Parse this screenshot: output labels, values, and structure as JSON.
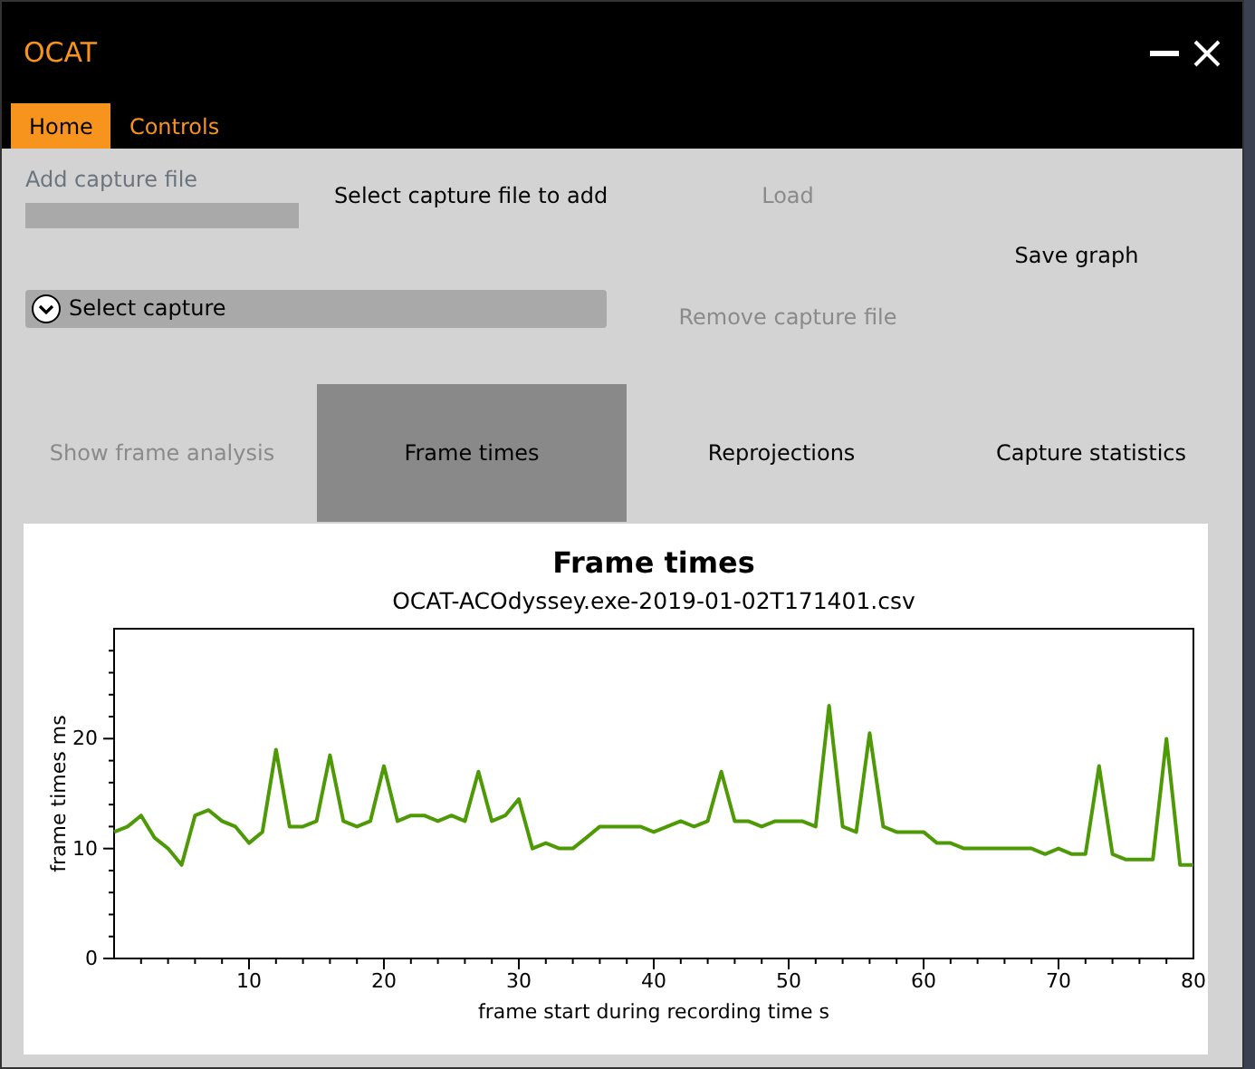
{
  "window": {
    "title": "OCAT"
  },
  "menu_tabs": [
    {
      "label": "Home",
      "selected": true
    },
    {
      "label": "Controls",
      "selected": false
    }
  ],
  "add_capture": {
    "label": "Add capture file",
    "select_button": "Select capture file to add",
    "load_button": {
      "label": "Load",
      "disabled": true
    }
  },
  "save_button": "Save graph",
  "capture_select": {
    "placeholder": "Select capture"
  },
  "remove_button": {
    "label": "Remove capture file",
    "disabled": true
  },
  "view_tabs": [
    {
      "label": "Show frame analysis",
      "selected": false,
      "disabled": true
    },
    {
      "label": "Frame times",
      "selected": true,
      "disabled": false
    },
    {
      "label": "Reprojections",
      "selected": false,
      "disabled": false
    },
    {
      "label": "Capture statistics",
      "selected": false,
      "disabled": false
    }
  ],
  "chart": {
    "chart_data": {
      "type": "line",
      "title": "Frame times",
      "subtitle": "OCAT-ACOdyssey.exe-2019-01-02T171401.csv",
      "xlabel": "frame start during recording time s",
      "ylabel": "frame times ms",
      "x": [
        0,
        1,
        2,
        3,
        4,
        5,
        6,
        7,
        8,
        9,
        10,
        11,
        12,
        13,
        14,
        15,
        16,
        17,
        18,
        19,
        20,
        21,
        22,
        23,
        24,
        25,
        26,
        27,
        28,
        29,
        30,
        31,
        32,
        33,
        34,
        35,
        36,
        37,
        38,
        39,
        40,
        41,
        42,
        43,
        44,
        45,
        46,
        47,
        48,
        49,
        50,
        51,
        52,
        53,
        54,
        55,
        56,
        57,
        58,
        59,
        60,
        61,
        62,
        63,
        64,
        65,
        66,
        67,
        68,
        69,
        70,
        71,
        72,
        73,
        74,
        75,
        76,
        77,
        78,
        79,
        80
      ],
      "series": [
        {
          "color": "#4e9a06",
          "values": [
            11.5,
            12,
            13,
            11,
            10,
            8.5,
            13,
            13.5,
            12.5,
            12,
            10.5,
            11.5,
            19,
            12,
            12,
            12.5,
            18.5,
            12.5,
            12,
            12.5,
            17.5,
            12.5,
            13,
            13,
            12.5,
            13,
            12.5,
            17,
            12.5,
            13,
            14.5,
            10,
            10.5,
            10,
            10,
            11,
            12,
            12,
            12,
            12,
            11.5,
            12,
            12.5,
            12,
            12.5,
            17,
            12.5,
            12.5,
            12,
            12.5,
            12.5,
            12.5,
            12,
            23,
            12,
            11.5,
            20.5,
            12,
            11.5,
            11.5,
            11.5,
            10.5,
            10.5,
            10,
            10,
            10,
            10,
            10,
            10,
            9.5,
            10,
            9.5,
            9.5,
            17.5,
            9.5,
            9,
            9,
            9,
            20,
            8.5,
            8.5
          ]
        }
      ],
      "xlim": [
        0,
        80
      ],
      "ylim": [
        0,
        30
      ],
      "xticks": [
        10,
        20,
        30,
        40,
        50,
        60,
        70,
        80
      ],
      "yticks": [
        0,
        10,
        20
      ]
    }
  }
}
